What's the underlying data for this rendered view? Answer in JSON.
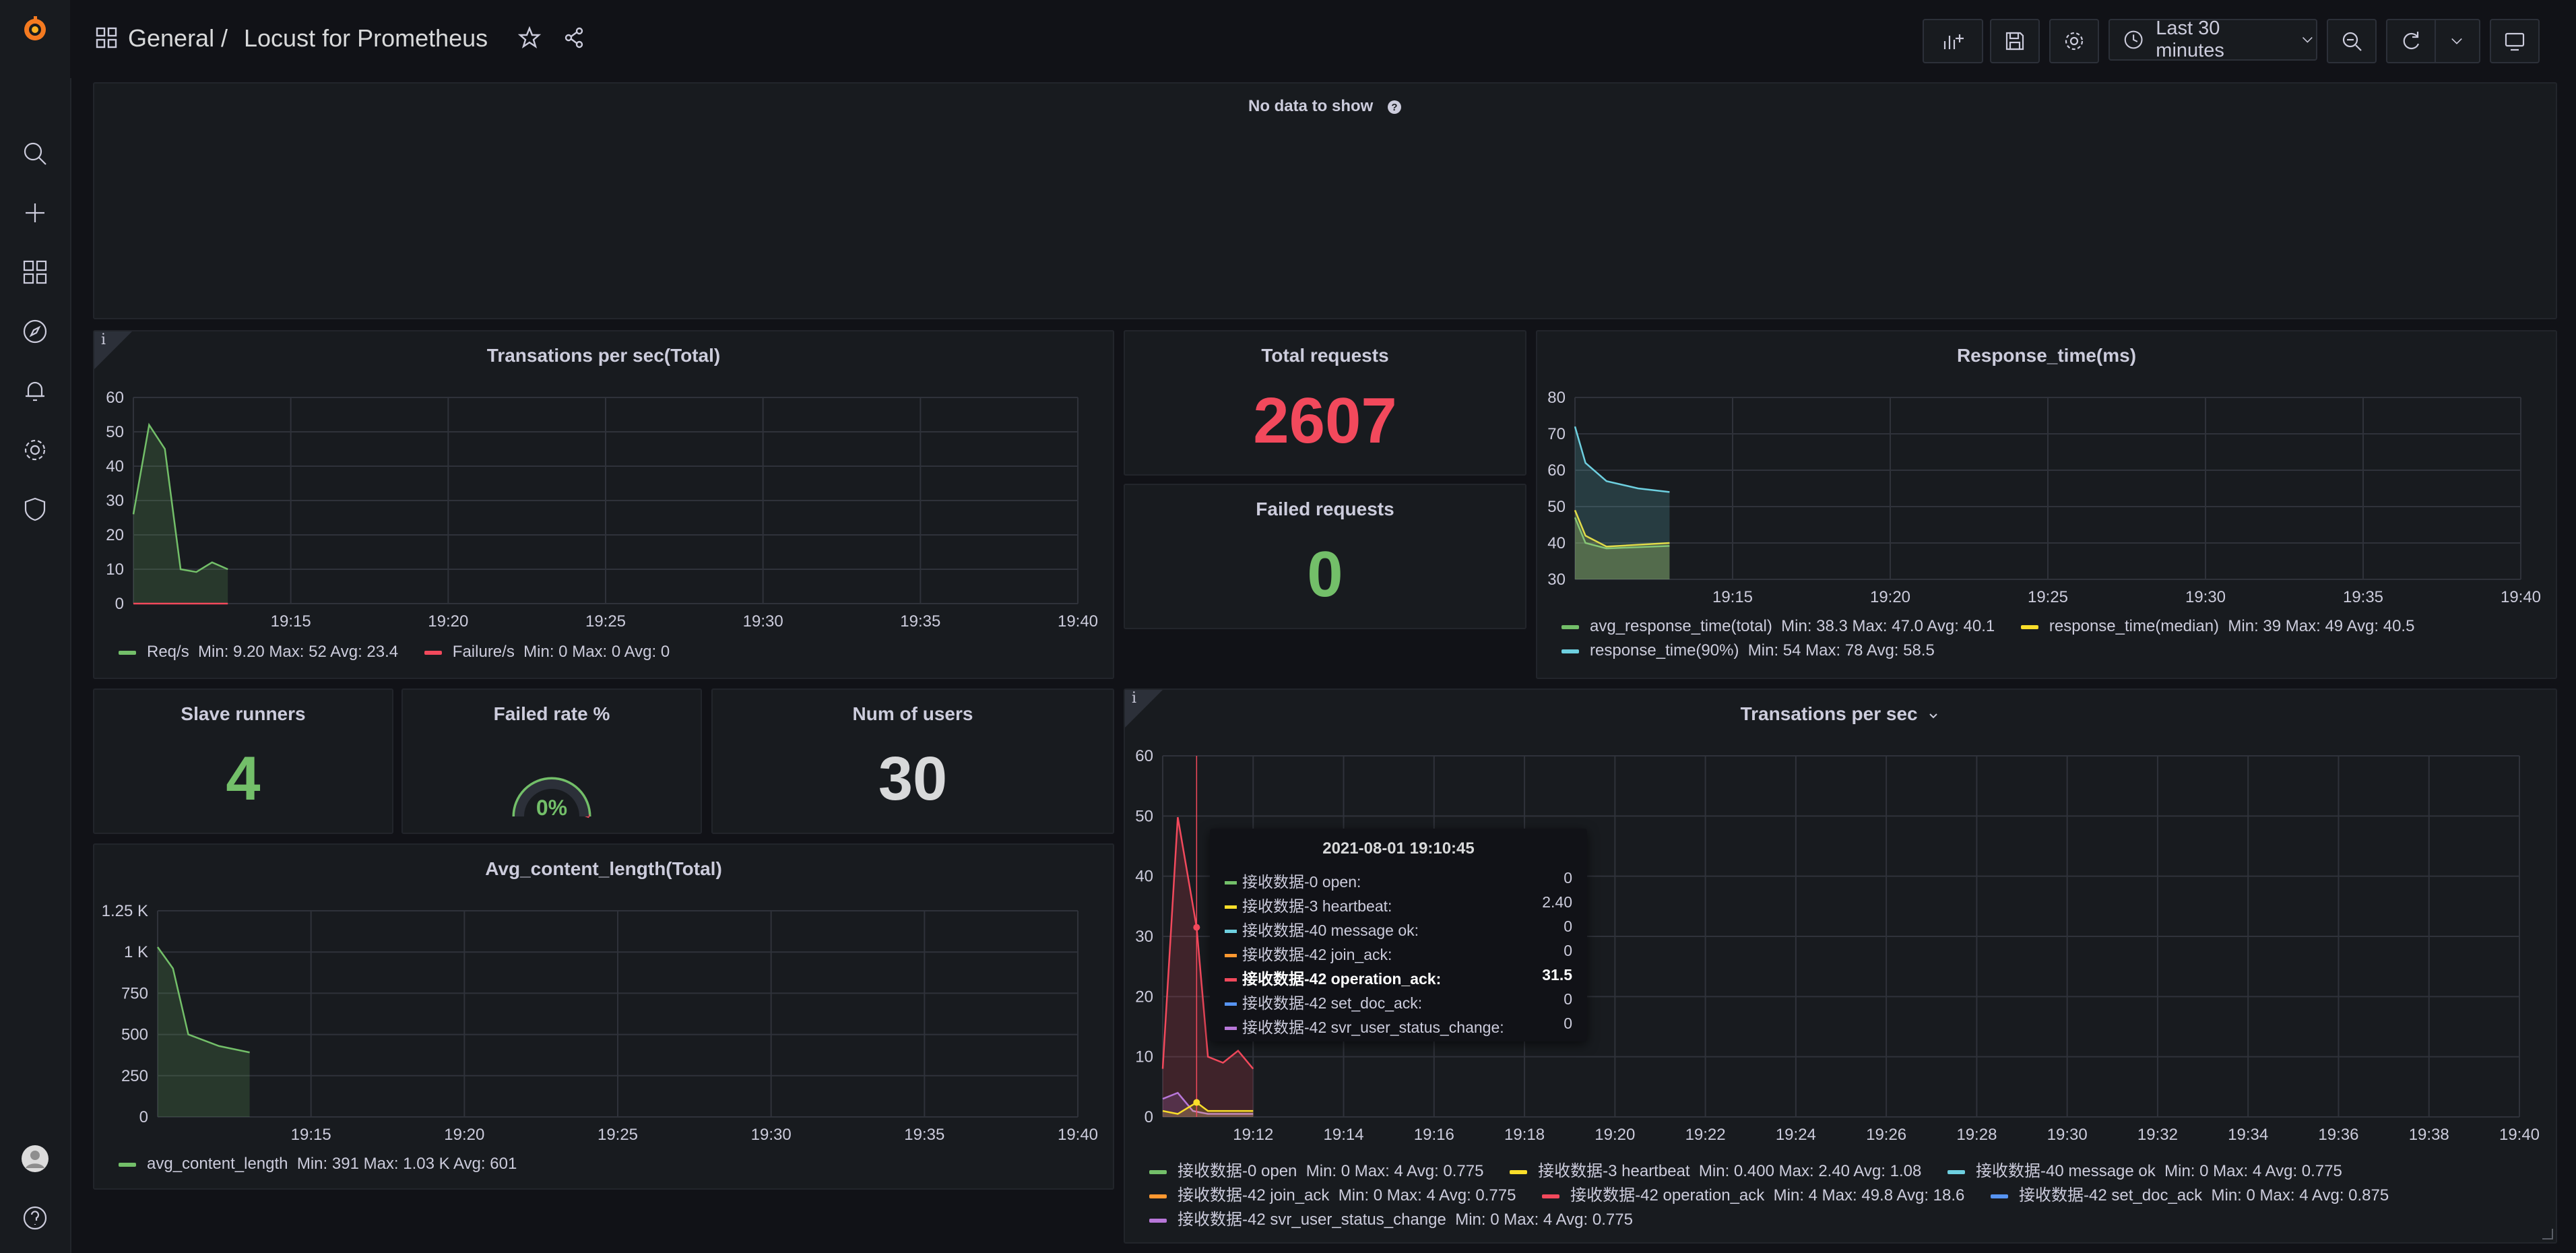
{
  "header": {
    "breadcrumb_folder": "General",
    "breadcrumb_sep": "/",
    "breadcrumb_title": "Locust for Prometheus",
    "time_range": "Last 30 minutes"
  },
  "sidebar": {
    "items": [
      "grafana-logo-icon",
      "search-icon",
      "plus-icon",
      "dashboards-icon",
      "explore-icon",
      "alerting-icon",
      "configuration-icon",
      "shield-icon",
      "avatar",
      "help-icon"
    ]
  },
  "colors": {
    "green": "#73bf69",
    "red": "#f2495c",
    "yellow": "#fade2a",
    "cyan": "#8ab8ff",
    "orange": "#ff9830",
    "blue": "#5794f2",
    "purple": "#b877d9",
    "teal": "#6ed0e0"
  },
  "panels": {
    "nodata": {
      "message": "No data to show",
      "help_icon": "question-circle-icon"
    },
    "tps_total": {
      "title": "Transations per sec(Total)",
      "legend": [
        {
          "name": "Req/s",
          "stats": "Min: 9.20  Max: 52  Avg: 23.4",
          "color": "#73bf69"
        },
        {
          "name": "Failure/s",
          "stats": "Min: 0  Max: 0  Avg: 0",
          "color": "#f2495c"
        }
      ]
    },
    "total_requests": {
      "title": "Total requests",
      "value": "2607"
    },
    "failed_requests": {
      "title": "Failed requests",
      "value": "0"
    },
    "response_time": {
      "title": "Response_time(ms)",
      "legend": [
        {
          "name": "avg_response_time(total)",
          "stats": "Min: 38.3  Max: 47.0  Avg: 40.1",
          "color": "#73bf69"
        },
        {
          "name": "response_time(median)",
          "stats": "Min: 39  Max: 49  Avg: 40.5",
          "color": "#fade2a"
        },
        {
          "name": "response_time(90%)",
          "stats": "Min: 54  Max: 78  Avg: 58.5",
          "color": "#6ed0e0"
        }
      ]
    },
    "slave_runners": {
      "title": "Slave runners",
      "value": "4"
    },
    "failed_rate": {
      "title": "Failed rate %",
      "value": "0%",
      "gauge_fraction": 0
    },
    "num_users": {
      "title": "Num of users",
      "value": "30"
    },
    "avg_content": {
      "title": "Avg_content_length(Total)",
      "legend": [
        {
          "name": "avg_content_length",
          "stats": "Min: 391  Max: 1.03 K  Avg: 601",
          "color": "#73bf69"
        }
      ]
    },
    "tps": {
      "title": "Transations per sec",
      "legend_rows": [
        [
          {
            "name": "接收数据-0 open",
            "stats": "Min: 0  Max: 4  Avg: 0.775",
            "color": "#73bf69"
          },
          {
            "name": "接收数据-3 heartbeat",
            "stats": "Min: 0.400  Max: 2.40  Avg: 1.08",
            "color": "#fade2a"
          },
          {
            "name": "接收数据-40 message ok",
            "stats": "Min: 0  Max: 4  Avg: 0.775",
            "color": "#6ed0e0"
          }
        ],
        [
          {
            "name": "接收数据-42 join_ack",
            "stats": "Min: 0  Max: 4  Avg: 0.775",
            "color": "#ff9830"
          },
          {
            "name": "接收数据-42 operation_ack",
            "stats": "Min: 4  Max: 49.8  Avg: 18.6",
            "color": "#f2495c"
          },
          {
            "name": "接收数据-42 set_doc_ack",
            "stats": "Min: 0  Max: 4  Avg: 0.875",
            "color": "#5794f2"
          }
        ],
        [
          {
            "name": "接收数据-42 svr_user_status_change",
            "stats": "Min: 0  Max: 4  Avg: 0.775",
            "color": "#b877d9"
          }
        ]
      ],
      "tooltip": {
        "time": "2021-08-01 19:10:45",
        "rows": [
          {
            "name": "接收数据-0 open:",
            "value": "0",
            "color": "#73bf69",
            "bold": false
          },
          {
            "name": "接收数据-3 heartbeat:",
            "value": "2.40",
            "color": "#fade2a",
            "bold": false
          },
          {
            "name": "接收数据-40 message ok:",
            "value": "0",
            "color": "#6ed0e0",
            "bold": false
          },
          {
            "name": "接收数据-42 join_ack:",
            "value": "0",
            "color": "#ff9830",
            "bold": false
          },
          {
            "name": "接收数据-42 operation_ack:",
            "value": "31.5",
            "color": "#f2495c",
            "bold": true
          },
          {
            "name": "接收数据-42 set_doc_ack:",
            "value": "0",
            "color": "#5794f2",
            "bold": false
          },
          {
            "name": "接收数据-42 svr_user_status_change:",
            "value": "0",
            "color": "#b877d9",
            "bold": false
          }
        ]
      }
    }
  },
  "chart_data": [
    {
      "type": "line",
      "title": "Transations per sec(Total)",
      "x_ticks": [
        "19:15",
        "19:20",
        "19:25",
        "19:30",
        "19:35",
        "19:40"
      ],
      "y_ticks": [
        "0",
        "10",
        "20",
        "30",
        "40",
        "50",
        "60"
      ],
      "ylim": [
        0,
        60
      ],
      "xlim": [
        "19:10",
        "19:40"
      ],
      "series": [
        {
          "name": "Req/s",
          "x": [
            "19:10",
            "19:10:30",
            "19:11",
            "19:11:30",
            "19:12",
            "19:12:30",
            "19:13"
          ],
          "values": [
            26,
            52,
            45,
            10,
            9.2,
            12,
            10
          ]
        },
        {
          "name": "Failure/s",
          "x": [
            "19:10",
            "19:13"
          ],
          "values": [
            0,
            0
          ]
        }
      ]
    },
    {
      "type": "line",
      "title": "Response_time(ms)",
      "x_ticks": [
        "19:15",
        "19:20",
        "19:25",
        "19:30",
        "19:35",
        "19:40"
      ],
      "y_ticks": [
        "30",
        "40",
        "50",
        "60",
        "70",
        "80"
      ],
      "ylim": [
        30,
        80
      ],
      "series": [
        {
          "name": "avg_response_time(total)",
          "x": [
            "19:10",
            "19:10:20",
            "19:11",
            "19:13"
          ],
          "values": [
            47,
            40,
            38.5,
            39.2
          ]
        },
        {
          "name": "response_time(median)",
          "x": [
            "19:10",
            "19:10:20",
            "19:11",
            "19:13"
          ],
          "values": [
            49,
            42,
            39,
            40
          ]
        },
        {
          "name": "response_time(90%)",
          "x": [
            "19:10",
            "19:10:20",
            "19:11",
            "19:12",
            "19:13"
          ],
          "values": [
            72,
            62,
            57,
            55,
            54
          ]
        }
      ]
    },
    {
      "type": "line",
      "title": "Avg_content_length(Total)",
      "x_ticks": [
        "19:15",
        "19:20",
        "19:25",
        "19:30",
        "19:35",
        "19:40"
      ],
      "y_ticks": [
        "0",
        "250",
        "500",
        "750",
        "1 K",
        "1.25 K"
      ],
      "ylim": [
        0,
        1250
      ],
      "series": [
        {
          "name": "avg_content_length",
          "x": [
            "19:10",
            "19:10:30",
            "19:11",
            "19:12",
            "19:13"
          ],
          "values": [
            1030,
            900,
            500,
            430,
            391
          ]
        }
      ]
    },
    {
      "type": "line",
      "title": "Transations per sec",
      "x_ticks": [
        "19:12",
        "19:14",
        "19:16",
        "19:18",
        "19:20",
        "19:22",
        "19:24",
        "19:26",
        "19:28",
        "19:30",
        "19:32",
        "19:34",
        "19:36",
        "19:38",
        "19:40"
      ],
      "y_ticks": [
        "0",
        "10",
        "20",
        "30",
        "40",
        "50",
        "60"
      ],
      "ylim": [
        0,
        60
      ],
      "series": [
        {
          "name": "接收数据-42 operation_ack",
          "x": [
            "19:10",
            "19:10:20",
            "19:10:45",
            "19:11",
            "19:11:20",
            "19:11:40",
            "19:12"
          ],
          "values": [
            8,
            49.8,
            31.5,
            10,
            9,
            11,
            8
          ]
        },
        {
          "name": "接收数据-0 open",
          "x": [
            "19:10",
            "19:10:20",
            "19:10:40",
            "19:11",
            "19:12"
          ],
          "values": [
            3,
            4,
            1,
            0.5,
            0.5
          ]
        },
        {
          "name": "接收数据-3 heartbeat",
          "x": [
            "19:10",
            "19:10:20",
            "19:10:45",
            "19:11",
            "19:12"
          ],
          "values": [
            1,
            0.5,
            2.4,
            1,
            1
          ]
        }
      ]
    }
  ]
}
